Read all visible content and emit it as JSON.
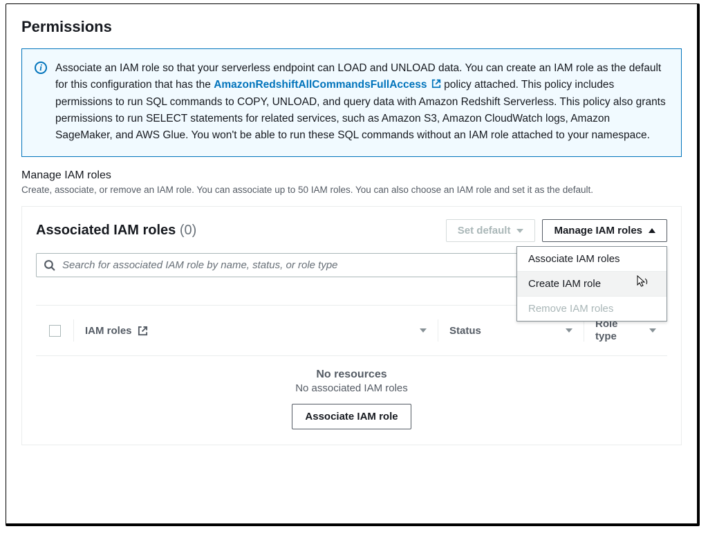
{
  "title": "Permissions",
  "info": {
    "text_before": "Associate an IAM role so that your serverless endpoint can LOAD and UNLOAD data. You can create an IAM role as the default for this configuration that has the ",
    "policy_link": "AmazonRedshiftAllCommandsFullAccess",
    "text_after": " policy attached. This policy includes permissions to run SQL commands to COPY, UNLOAD, and query data with Amazon Redshift Serverless. This policy also grants permissions to run SELECT statements for related services, such as Amazon S3, Amazon CloudWatch logs, Amazon SageMaker, and AWS Glue. You won't be able to run these SQL commands without an IAM role attached to your namespace."
  },
  "manage": {
    "heading": "Manage IAM roles",
    "desc": "Create, associate, or remove an IAM role. You can associate up to 50 IAM roles. You can also choose an IAM role and set it as the default."
  },
  "inner": {
    "title": "Associated IAM roles",
    "count": "(0)",
    "set_default": "Set default",
    "manage_btn": "Manage IAM roles",
    "search_placeholder": "Search for associated IAM role by name, status, or role type"
  },
  "dropdown": {
    "associate": "Associate IAM roles",
    "create": "Create IAM role",
    "remove": "Remove IAM roles"
  },
  "columns": {
    "roles": "IAM roles",
    "status": "Status",
    "type": "Role type"
  },
  "empty": {
    "title": "No resources",
    "sub": "No associated IAM roles",
    "cta": "Associate IAM role"
  }
}
